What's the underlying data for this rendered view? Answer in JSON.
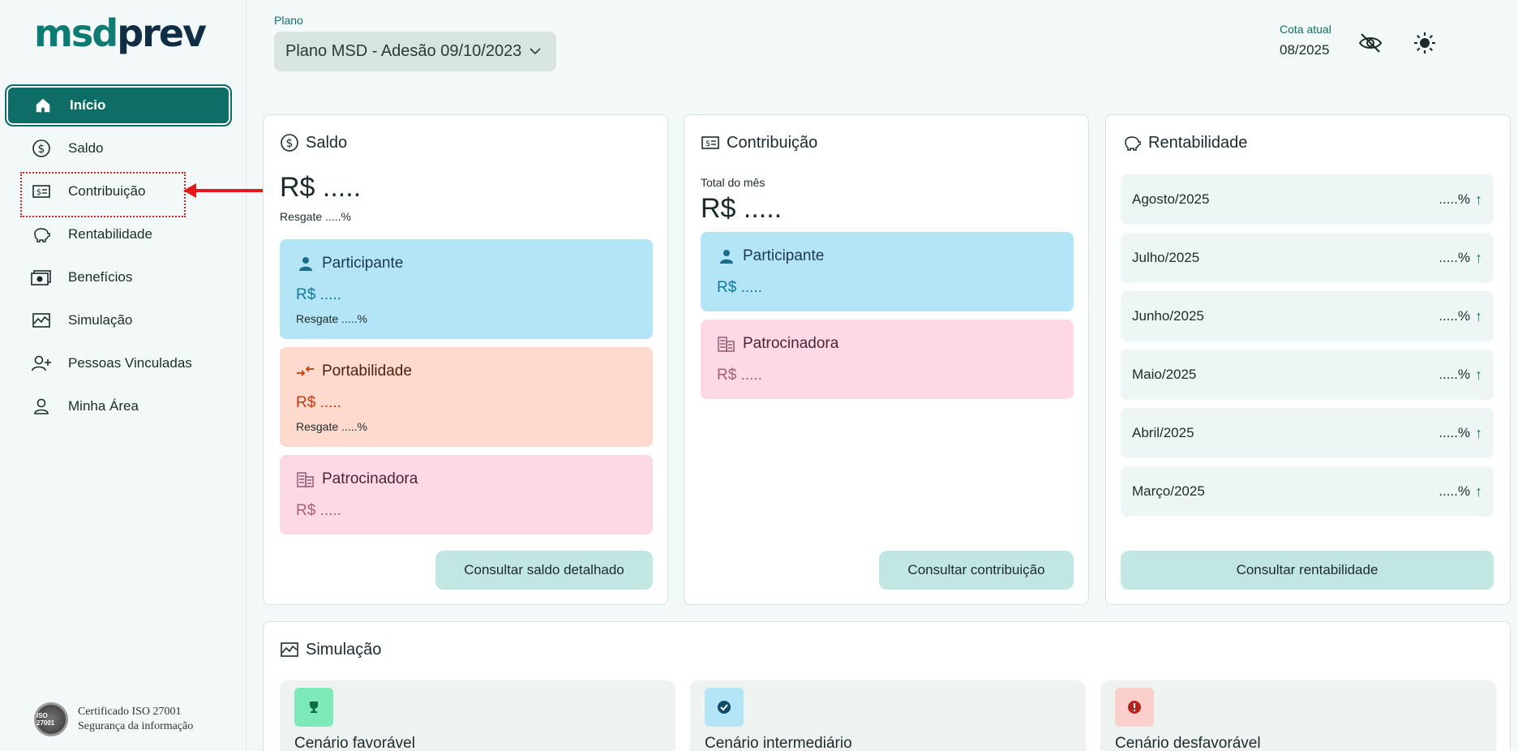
{
  "brand": {
    "logo_part1": "msd",
    "logo_part2": "prev"
  },
  "sidebar": {
    "items": [
      {
        "label": "Início",
        "icon": "home-icon"
      },
      {
        "label": "Saldo",
        "icon": "dollar-circle-icon"
      },
      {
        "label": "Contribuição",
        "icon": "money-bill-icon"
      },
      {
        "label": "Rentabilidade",
        "icon": "piggy-bank-icon"
      },
      {
        "label": "Benefícios",
        "icon": "cash-icon"
      },
      {
        "label": "Simulação",
        "icon": "chart-line-icon"
      },
      {
        "label": "Pessoas Vinculadas",
        "icon": "user-plus-icon"
      },
      {
        "label": "Minha Área",
        "icon": "user-icon"
      }
    ],
    "iso_seal": "ISO 27001",
    "iso_line1": "Certificado ISO 27001",
    "iso_line2": "Segurança da informação"
  },
  "header": {
    "plano_label": "Plano",
    "plano_value": "Plano MSD - Adesão 09/10/2023",
    "cota_label": "Cota atual",
    "cota_value": "08/2025"
  },
  "saldo": {
    "title": "Saldo",
    "amount": "R$ .....",
    "resgate": "Resgate .....%",
    "participante": {
      "title": "Participante",
      "amount": "R$ .....",
      "resgate": "Resgate .....%"
    },
    "portabilidade": {
      "title": "Portabilidade",
      "amount": "R$ .....",
      "resgate": "Resgate .....%"
    },
    "patrocinadora": {
      "title": "Patrocinadora",
      "amount": "R$ ....."
    },
    "button": "Consultar saldo detalhado"
  },
  "contribuicao": {
    "title": "Contribuição",
    "total_label": "Total do mês",
    "amount": "R$ .....",
    "participante": {
      "title": "Participante",
      "amount": "R$ ....."
    },
    "patrocinadora": {
      "title": "Patrocinadora",
      "amount": "R$ ....."
    },
    "button": "Consultar contribuição"
  },
  "rentabilidade": {
    "title": "Rentabilidade",
    "rows": [
      {
        "month": "Agosto/2025",
        "pct": ".....%"
      },
      {
        "month": "Julho/2025",
        "pct": ".....%"
      },
      {
        "month": "Junho/2025",
        "pct": ".....%"
      },
      {
        "month": "Maio/2025",
        "pct": ".....%"
      },
      {
        "month": "Abril/2025",
        "pct": ".....%"
      },
      {
        "month": "Março/2025",
        "pct": ".....%"
      }
    ],
    "up_symbol": "↑",
    "button": "Consultar rentabilidade"
  },
  "simulacao": {
    "title": "Simulação",
    "scenarios": [
      {
        "label": "Cenário favorável",
        "icon": "trophy-icon",
        "color": "#7de8b8"
      },
      {
        "label": "Cenário intermediário",
        "icon": "check-circle-icon",
        "color": "#b3e5f7"
      },
      {
        "label": "Cenário desfavorável",
        "icon": "alert-circle-icon",
        "color": "#fbd0cc"
      }
    ]
  }
}
